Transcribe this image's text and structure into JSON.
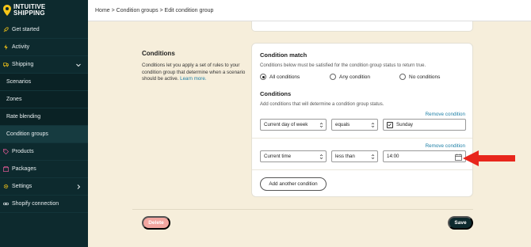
{
  "brand": {
    "logo_line1": "INTUITIVE",
    "logo_line2": "SHIPPING",
    "accent": "#f5c518"
  },
  "sidebar": {
    "items": [
      {
        "label": "Get started",
        "icon": "rocket-icon"
      },
      {
        "label": "Activity",
        "icon": "lightning-icon"
      },
      {
        "label": "Shipping",
        "icon": "truck-icon"
      },
      {
        "label": "Scenarios"
      },
      {
        "label": "Zones"
      },
      {
        "label": "Rate blending"
      },
      {
        "label": "Condition groups"
      },
      {
        "label": "Products",
        "icon": "tag-icon"
      },
      {
        "label": "Packages",
        "icon": "box-icon"
      },
      {
        "label": "Settings",
        "icon": "gear-icon"
      },
      {
        "label": "Shopify connection",
        "icon": "link-icon"
      }
    ]
  },
  "breadcrumb": "Home > Condition groups > Edit condition group",
  "section": {
    "title": "Conditions",
    "description": "Conditions let you apply a set of rules to your condition group that determine when a scenario should be active.",
    "learn_more": "Learn more."
  },
  "condition_match": {
    "title": "Condition match",
    "help": "Conditions below must be satisfied for the condition group status to return true.",
    "options": [
      "All conditions",
      "Any condition",
      "No conditions"
    ],
    "selected": "All conditions"
  },
  "conditions": {
    "title": "Conditions",
    "help": "Add conditions that will determine a condition group status.",
    "remove_label": "Remove condition",
    "rows": [
      {
        "field": "Current day of week",
        "operator": "equals",
        "value": "Sunday",
        "checked": true
      },
      {
        "field": "Current time",
        "operator": "less than",
        "value": "14:00"
      }
    ],
    "add_label": "Add another condition"
  },
  "footer": {
    "delete_label": "Delete",
    "save_label": "Save"
  },
  "colors": {
    "sidebar_bg": "#0d2a2e",
    "page_bg": "#f6eedb",
    "link": "#1d7fa6",
    "delete": "#f2a6a0",
    "arrow": "#e8261c"
  }
}
